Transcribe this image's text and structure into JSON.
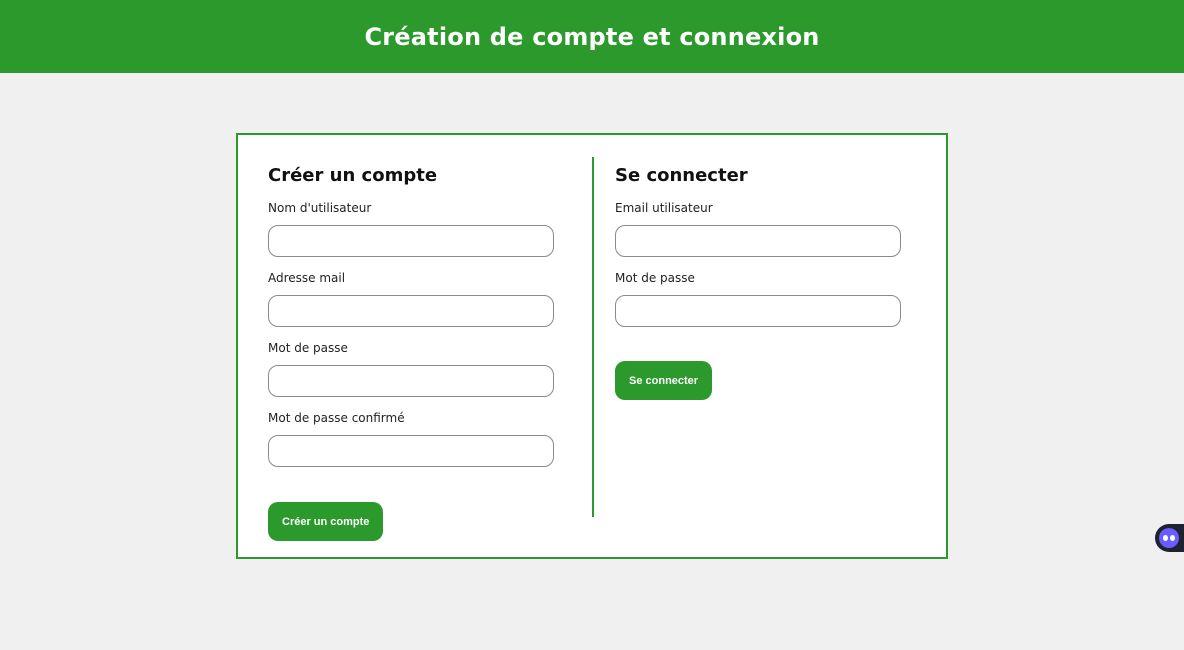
{
  "header": {
    "title": "Création de compte et connexion"
  },
  "register": {
    "title": "Créer un compte",
    "fields": [
      {
        "label": "Nom d'utilisateur",
        "value": ""
      },
      {
        "label": "Adresse mail",
        "value": ""
      },
      {
        "label": "Mot de passe",
        "value": ""
      },
      {
        "label": "Mot de passe confirmé",
        "value": ""
      }
    ],
    "submit_label": "Créer un compte"
  },
  "login": {
    "title": "Se connecter",
    "fields": [
      {
        "label": "Email utilisateur",
        "value": ""
      },
      {
        "label": "Mot de passe",
        "value": ""
      }
    ],
    "submit_label": "Se connecter"
  },
  "colors": {
    "accent": "#2b992b",
    "background": "#f0f0f0"
  },
  "widget": {
    "icon": "assistant-bot-icon"
  }
}
